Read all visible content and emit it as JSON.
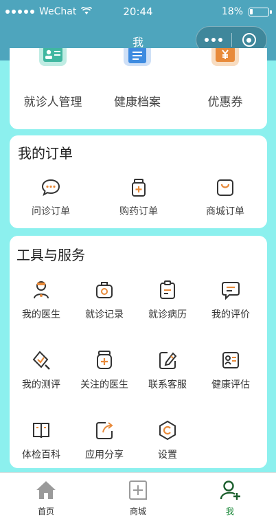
{
  "status_bar": {
    "carrier": "WeChat",
    "time": "20:44",
    "battery_percent": "18%",
    "battery_level": 0.18
  },
  "nav": {
    "title": "我"
  },
  "services": {
    "items": [
      {
        "label": "就诊人管理",
        "icon": "patient-card-icon",
        "color": "#3fb7a0"
      },
      {
        "label": "健康档案",
        "icon": "health-record-icon",
        "color": "#3e8be0"
      },
      {
        "label": "优惠券",
        "icon": "coupon-icon",
        "color": "#e88a3a"
      }
    ]
  },
  "orders": {
    "title": "我的订单",
    "items": [
      {
        "label": "问诊订单",
        "icon": "chat-bubble-icon"
      },
      {
        "label": "购药订单",
        "icon": "medicine-bottle-icon"
      },
      {
        "label": "商城订单",
        "icon": "shopping-bag-icon"
      }
    ]
  },
  "tools": {
    "title": "工具与服务",
    "items": [
      {
        "label": "我的医生",
        "icon": "doctor-icon"
      },
      {
        "label": "就诊记录",
        "icon": "medical-kit-icon"
      },
      {
        "label": "就诊病历",
        "icon": "clipboard-icon"
      },
      {
        "label": "我的评价",
        "icon": "comment-icon"
      },
      {
        "label": "我的测评",
        "icon": "assessment-icon"
      },
      {
        "label": "关注的医生",
        "icon": "followed-doctor-icon"
      },
      {
        "label": "联系客服",
        "icon": "edit-icon"
      },
      {
        "label": "健康评估",
        "icon": "id-card-icon"
      },
      {
        "label": "体检百科",
        "icon": "book-icon"
      },
      {
        "label": "应用分享",
        "icon": "share-icon"
      },
      {
        "label": "设置",
        "icon": "settings-icon"
      }
    ]
  },
  "tabbar": {
    "tabs": [
      {
        "label": "首页",
        "icon": "home-icon"
      },
      {
        "label": "商城",
        "icon": "store-icon"
      },
      {
        "label": "我",
        "icon": "profile-icon"
      }
    ],
    "active_color": "#1e8a3c"
  }
}
